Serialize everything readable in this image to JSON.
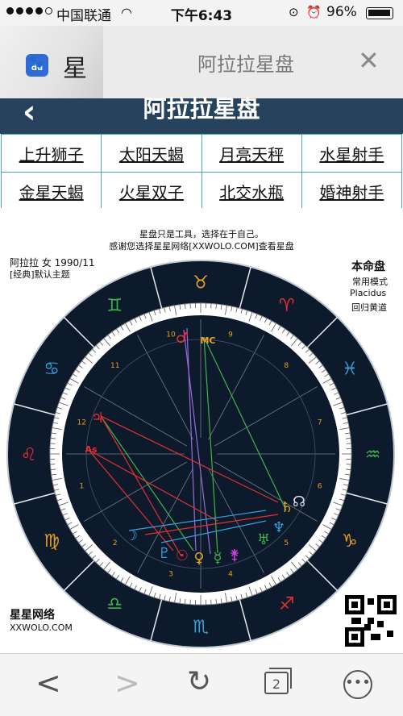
{
  "status_bar": {
    "carrier": "中国联通",
    "time": "下午6:43",
    "battery": "96%"
  },
  "browser": {
    "tab_left_title": "星",
    "tab_title": "阿拉拉星盘",
    "close_glyph": "✕",
    "toolbar": {
      "tabs_count": "2"
    }
  },
  "page": {
    "title": "阿拉拉星盘",
    "back_glyph": "‹",
    "links": [
      [
        "上升狮子",
        "太阳天蝎",
        "月亮天秤",
        "水星射手"
      ],
      [
        "金星天蝎",
        "火星双子",
        "北交水瓶",
        "婚神射手"
      ]
    ]
  },
  "chart": {
    "notice_line1": "星盘只是工具，选择在于自己。",
    "notice_line2": "感谢您选择星星网络[XXWOLO.COM]查看星盘",
    "person_info": "阿拉拉 女 1990/11",
    "theme": "[经典]默认主题",
    "chart_type": "本命盘",
    "mode": "常用模式",
    "house_system": "Placidus",
    "zodiac": "回归黄道",
    "brand": "星星网络",
    "brand_url": "XXWOLO.COM"
  },
  "chart_data": {
    "type": "astrology-wheel",
    "signs": [
      {
        "glyph": "♋",
        "name": "cancer",
        "color": "#3a9fd8"
      },
      {
        "glyph": "♊",
        "name": "gemini",
        "color": "#3db54a"
      },
      {
        "glyph": "♉",
        "name": "taurus",
        "color": "#e8a020"
      },
      {
        "glyph": "♈",
        "name": "aries",
        "color": "#e43030"
      },
      {
        "glyph": "♓",
        "name": "pisces",
        "color": "#3a9fd8"
      },
      {
        "glyph": "♒",
        "name": "aquarius",
        "color": "#3db54a"
      },
      {
        "glyph": "♑",
        "name": "capricorn",
        "color": "#e8a020"
      },
      {
        "glyph": "♐",
        "name": "sagittarius",
        "color": "#e43030"
      },
      {
        "glyph": "♏",
        "name": "scorpio",
        "color": "#3a9fd8"
      },
      {
        "glyph": "♎",
        "name": "libra",
        "color": "#3db54a"
      },
      {
        "glyph": "♍",
        "name": "virgo",
        "color": "#e8a020"
      },
      {
        "glyph": "♌",
        "name": "leo",
        "color": "#e43030"
      }
    ],
    "houses": [
      "10",
      "11",
      "12",
      "1",
      "2",
      "3",
      "4",
      "5",
      "6",
      "7",
      "8",
      "9"
    ],
    "planets": [
      {
        "glyph": "♂",
        "name": "mars",
        "color": "#e43030"
      },
      {
        "glyph": "MC",
        "name": "midheaven",
        "color": "#e8a020"
      },
      {
        "glyph": "♃",
        "name": "jupiter",
        "color": "#e43030"
      },
      {
        "glyph": "As",
        "name": "ascendant",
        "color": "#e43030"
      },
      {
        "glyph": "☊",
        "name": "north-node",
        "color": "#dddddd"
      },
      {
        "glyph": "♄",
        "name": "saturn",
        "color": "#e8a020"
      },
      {
        "glyph": "♆",
        "name": "neptune",
        "color": "#3a9fd8"
      },
      {
        "glyph": "♅",
        "name": "uranus",
        "color": "#3db54a"
      },
      {
        "glyph": "☽",
        "name": "moon",
        "color": "#3a9fd8"
      },
      {
        "glyph": "♇",
        "name": "pluto",
        "color": "#3a9fd8"
      },
      {
        "glyph": "☉",
        "name": "sun",
        "color": "#e43030"
      },
      {
        "glyph": "♀",
        "name": "venus",
        "color": "#e8a020"
      },
      {
        "glyph": "☿",
        "name": "mercury",
        "color": "#3db54a"
      },
      {
        "glyph": "⚵",
        "name": "juno",
        "color": "#d040e0"
      }
    ]
  }
}
